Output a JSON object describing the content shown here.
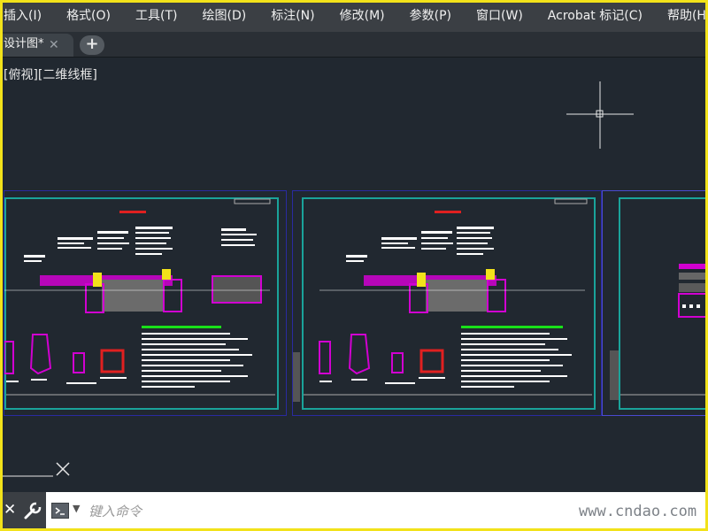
{
  "menu": [
    "插入(I)",
    "格式(O)",
    "工具(T)",
    "绘图(D)",
    "标注(N)",
    "修改(M)",
    "参数(P)",
    "窗口(W)",
    "Acrobat 标记(C)",
    "帮助(H)"
  ],
  "tab": {
    "title": "设计图*",
    "close": "✕",
    "new": "+"
  },
  "viewport_label": "[俯视][二维线框]",
  "command": {
    "placeholder": "键入命令",
    "close": "✕"
  },
  "watermark": "www.cndao.com",
  "colors": {
    "canvas": "#212830",
    "menubar": "#3b3f44",
    "sheet_border": "#1aa39a",
    "accent_magenta": "#d100d1",
    "accent_red": "#e02020",
    "accent_green": "#19e019",
    "frame": "#f2e21a"
  }
}
